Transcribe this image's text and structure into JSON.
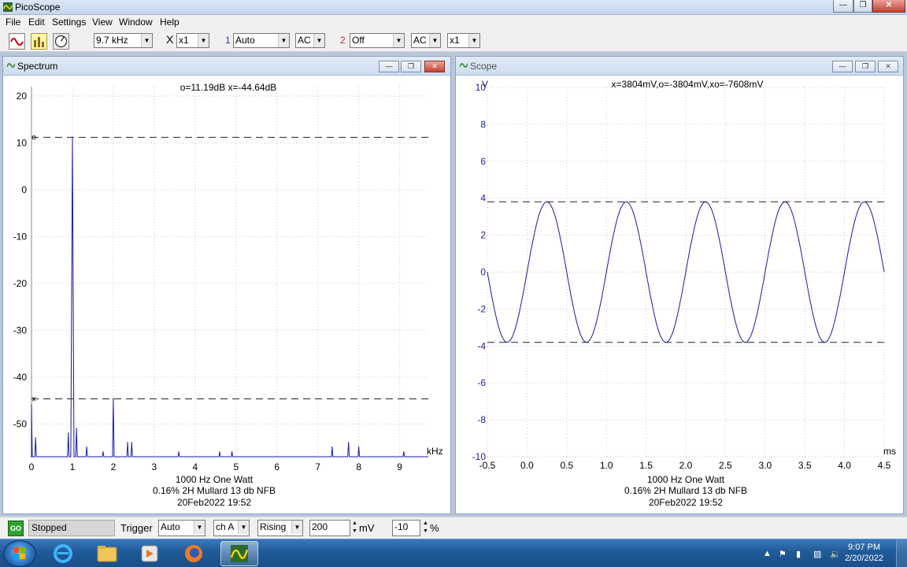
{
  "app": {
    "title": "PicoScope"
  },
  "menu": [
    "File",
    "Edit",
    "Settings",
    "View",
    "Window",
    "Help"
  ],
  "toolbar": {
    "frequency": "9.7 kHz",
    "mult_symbol": "X",
    "multiplier": "x1",
    "ch1_label": "1",
    "ch1_range": "Auto",
    "ch1_coupling": "AC",
    "ch2_label": "2",
    "ch2_range": "Off",
    "ch2_coupling": "AC",
    "ch2_multiplier": "x1"
  },
  "spectrum": {
    "title": "Spectrum",
    "readout": "o=11.19dB  x=-44.64dB",
    "y_ticks": [
      "20",
      "10",
      "0",
      "-10",
      "-20",
      "-30",
      "-40",
      "-50"
    ],
    "x_ticks": [
      "0",
      "1",
      "2",
      "3",
      "4",
      "5",
      "6",
      "7",
      "8",
      "9"
    ],
    "x_unit": "kHz",
    "caption": [
      "1000 Hz One Watt",
      "0.16% 2H Mullard 13 db NFB",
      "20Feb2022  19:52"
    ]
  },
  "scope": {
    "title": "Scope",
    "y_unit": "V",
    "readout": "x=3804mV,o=-3804mV,xo=-7608mV",
    "y_ticks": [
      "10",
      "8",
      "6",
      "4",
      "2",
      "0",
      "-2",
      "-4",
      "-6",
      "-8",
      "-10"
    ],
    "x_ticks": [
      "-0.5",
      "0.0",
      "0.5",
      "1.0",
      "1.5",
      "2.0",
      "2.5",
      "3.0",
      "3.5",
      "4.0",
      "4.5"
    ],
    "x_unit": "ms",
    "caption": [
      "1000 Hz One Watt",
      "0.16% 2H Mullard 13 db NFB",
      "20Feb2022  19:52"
    ]
  },
  "status": {
    "go_label": "GO",
    "state": "Stopped",
    "trigger_label": "Trigger",
    "trigger_mode": "Auto",
    "trigger_channel": "ch A",
    "trigger_edge": "Rising",
    "trigger_level": "200",
    "trigger_level_unit": "mV",
    "pretrigger": "-10",
    "pretrigger_unit": "%"
  },
  "taskbar": {
    "time": "9:07 PM",
    "date": "2/20/2022"
  },
  "chart_data": [
    {
      "type": "line",
      "name": "Spectrum",
      "xlabel": "kHz",
      "ylabel": "dB",
      "xlim": [
        0,
        9.7
      ],
      "ylim": [
        -57,
        22
      ],
      "grid": true,
      "noise_floor": -57,
      "peaks": [
        {
          "x": 0.0,
          "y": -46
        },
        {
          "x": 0.1,
          "y": -53
        },
        {
          "x": 0.9,
          "y": -52
        },
        {
          "x": 1.0,
          "y": 11.19
        },
        {
          "x": 1.1,
          "y": -51
        },
        {
          "x": 1.35,
          "y": -55
        },
        {
          "x": 1.75,
          "y": -56
        },
        {
          "x": 2.0,
          "y": -44.64
        },
        {
          "x": 2.35,
          "y": -54
        },
        {
          "x": 2.45,
          "y": -54
        },
        {
          "x": 3.6,
          "y": -56
        },
        {
          "x": 4.6,
          "y": -56
        },
        {
          "x": 4.9,
          "y": -56
        },
        {
          "x": 7.35,
          "y": -55
        },
        {
          "x": 7.75,
          "y": -54
        },
        {
          "x": 8.0,
          "y": -55
        },
        {
          "x": 9.1,
          "y": -56
        }
      ],
      "markers": [
        {
          "name": "o",
          "value": 11.19
        },
        {
          "name": "x",
          "value": -44.64
        }
      ]
    },
    {
      "type": "line",
      "name": "Scope",
      "xlabel": "ms",
      "ylabel": "V",
      "xlim": [
        -0.5,
        4.5
      ],
      "ylim": [
        -10,
        10
      ],
      "grid": true,
      "waveform": {
        "shape": "sine",
        "frequency_hz": 1000,
        "amplitude_v": 3.804,
        "peak_time_ms": 0.25
      },
      "markers": [
        {
          "name": "x",
          "value": 3.804
        },
        {
          "name": "o",
          "value": -3.804
        }
      ]
    }
  ]
}
